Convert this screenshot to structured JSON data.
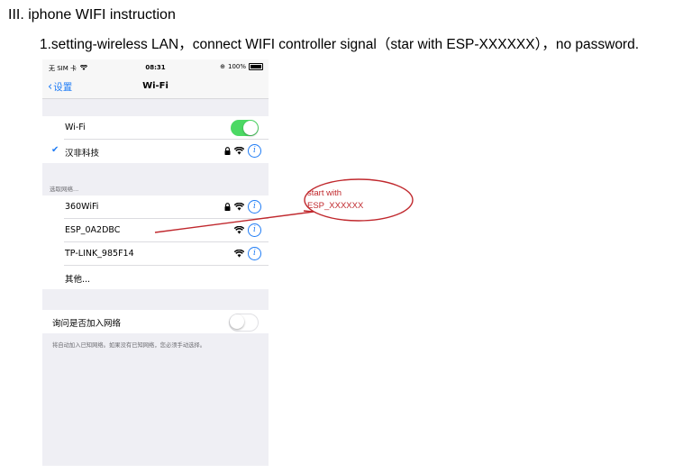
{
  "document": {
    "heading": "III. iphone WIFI instruction",
    "instruction": "1.setting-wireless LAN，connect WIFI controller signal（star with ESP-XXXXXX），no password."
  },
  "statusbar": {
    "carrier": "无 SIM 卡",
    "time": "08:31",
    "battery": "100%"
  },
  "navbar": {
    "back_label": "设置",
    "title": "Wi-Fi"
  },
  "wifi_toggle": {
    "label": "Wi-Fi",
    "state": "on"
  },
  "connected_network": {
    "name": "汉非科技"
  },
  "networks_section": {
    "header": "选取网络..."
  },
  "networks": [
    {
      "name": "360WiFi"
    },
    {
      "name": "ESP_0A2DBC"
    },
    {
      "name": "TP-LINK_985F14"
    },
    {
      "name": "其他..."
    }
  ],
  "ask_to_join": {
    "label": "询问是否加入网络",
    "state": "off",
    "note": "将自动加入已知网络。如果没有已知网络，您必须手动选择。"
  },
  "annotation": {
    "line1": "start with",
    "line2": "ESP_XXXXXX"
  },
  "colors": {
    "accent": "#1f7cf5",
    "toggle_on": "#4cd964",
    "annotation": "#c0282d"
  }
}
